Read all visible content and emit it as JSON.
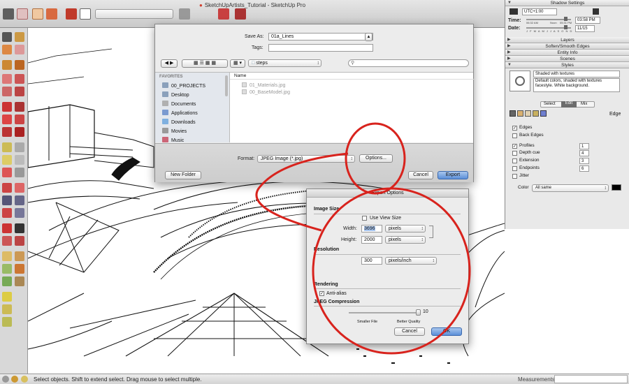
{
  "window": {
    "title": "SketchUpArtists_Tutorial - SketchUp Pro"
  },
  "status_bar": {
    "text": "Select objects. Shift to extend select. Drag mouse to select multiple.",
    "measurements_label": "Measurements"
  },
  "save_dialog": {
    "save_as_label": "Save As:",
    "save_as_value": "01a_Lines",
    "tags_label": "Tags:",
    "tags_value": "",
    "folder": "steps",
    "search_placeholder": "",
    "favorites_label": "FAVORITES",
    "favorites": [
      "00_PROJECTS",
      "Desktop",
      "Documents",
      "Applications",
      "Downloads",
      "Movies",
      "Music"
    ],
    "column_name": "Name",
    "files": [
      "01_Materials.jpg",
      "00_BaseModel.jpg"
    ],
    "format_label": "Format:",
    "format_value": "JPEG Image (*.jpg)",
    "options_button": "Options...",
    "new_folder_button": "New Folder",
    "cancel_button": "Cancel",
    "export_button": "Export"
  },
  "export_options": {
    "title": "Export Options",
    "image_size_label": "Image Size",
    "use_view_size_label": "Use View Size",
    "use_view_size_checked": false,
    "width_label": "Width:",
    "width_value": "3696",
    "width_unit": "pixels",
    "height_label": "Height:",
    "height_value": "2000",
    "height_unit": "pixels",
    "resolution_label": "Resolution",
    "resolution_value": "300",
    "resolution_unit": "pixels/inch",
    "rendering_label": "Rendering",
    "anti_alias_label": "Anti-alias",
    "anti_alias_checked": true,
    "jpeg_label": "JPEG Compression",
    "jpeg_value": "10",
    "jpeg_level": 1.0,
    "smaller_label": "Smaller File",
    "better_label": "Better Quality",
    "cancel_button": "Cancel",
    "ok_button": "OK"
  },
  "right_panel": {
    "shadow_title": "Shadow Settings",
    "timezone": "UTC+1:00",
    "time_label": "Time:",
    "time_start": "06:32 AM",
    "time_mid": "Noon",
    "time_end": "05:31 PM",
    "time_value": "03:58 PM",
    "date_label": "Date:",
    "months": "J F M A M J J A S O N D",
    "date_value": "11/15",
    "sections": [
      "Layers",
      "Soften/Smooth Edges",
      "Entity Info",
      "Scenes",
      "Styles"
    ],
    "style_name": "Shaded with textures",
    "style_desc": "Default colors, shaded with textures facestyle. White background.",
    "tabs": [
      "Select",
      "Edit",
      "Mix"
    ],
    "edge_label": "Edge",
    "edge_options": [
      {
        "label": "Edges",
        "checked": true,
        "value": ""
      },
      {
        "label": "Back Edges",
        "checked": false,
        "value": ""
      },
      {
        "label": "Profiles",
        "checked": true,
        "value": "1"
      },
      {
        "label": "Depth cue",
        "checked": false,
        "value": "4"
      },
      {
        "label": "Extension",
        "checked": false,
        "value": "3"
      },
      {
        "label": "Endpoints",
        "checked": false,
        "value": "6"
      },
      {
        "label": "Jitter",
        "checked": false,
        "value": ""
      }
    ],
    "color_label": "Color",
    "color_value": "All same"
  },
  "colors": {
    "annotation_red": "#d8231d",
    "accent_blue": "#5b8fd8"
  }
}
